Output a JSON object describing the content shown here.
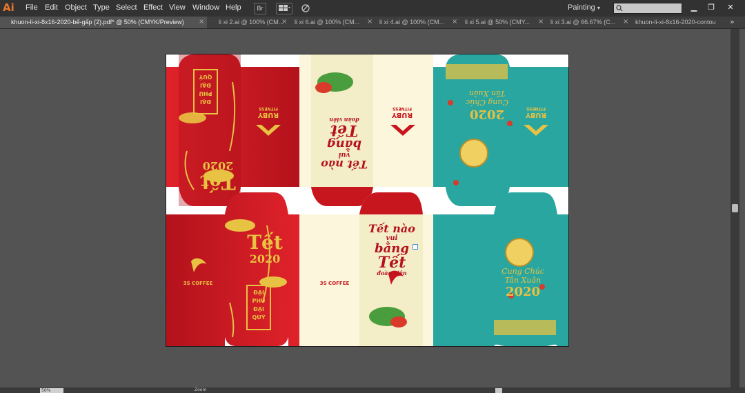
{
  "app": {
    "logo": "Ai"
  },
  "menu": [
    "File",
    "Edit",
    "Object",
    "Type",
    "Select",
    "Effect",
    "View",
    "Window",
    "Help"
  ],
  "toolbar": {
    "bridge_label": "Br",
    "arrange_icon": "arrange-documents-icon",
    "gpu_icon": "gpu-performance-icon"
  },
  "workspace": {
    "label": "Painting"
  },
  "search": {
    "placeholder": ""
  },
  "window_controls": {
    "minimize": "▁",
    "restore": "❐",
    "close": "✕"
  },
  "tabs": [
    {
      "label": "khuon-li-xi-8x16-2020-bế-gấp (2).pdf* @ 50% (CMYK/Preview)",
      "active": true
    },
    {
      "label": "li xi 2.ai @ 100% (CM...",
      "active": false
    },
    {
      "label": "li xi 6.ai @ 100% (CM...",
      "active": false
    },
    {
      "label": "li xi 4.ai @ 100% (CM...",
      "active": false
    },
    {
      "label": "li xi 5.ai @ 50% (CMY...",
      "active": false
    },
    {
      "label": "li xi 3.ai @ 66.67% (C...",
      "active": false
    },
    {
      "label": "khuon-li-xi-8x16-2020-contou",
      "active": false
    }
  ],
  "tab_close": "×",
  "artwork": {
    "tet": "Tết",
    "year": "2020",
    "phu_quy": [
      "ĐẠI",
      "PHÚ",
      "ĐẠI",
      "QUÝ"
    ],
    "brand_ruby": "RUBY",
    "brand_ruby_sub": "FITNESS",
    "brand_coffee": "3S COFFEE",
    "calli_1": "Tết nào",
    "calli_2": "vui",
    "calli_3": "bằng",
    "calli_4": "Tết",
    "calli_5": "đoàn viên",
    "cung_chuc": "Cung Chúc",
    "tan_xuan": "Tân Xuân"
  },
  "statusbar": {
    "zoom": "50%",
    "tool": "Zoom"
  },
  "colors": {
    "red": "#c8161e",
    "dark_red": "#a8101a",
    "cream": "#fbf6dc",
    "teal": "#2aa6a0",
    "gold": "#e8c242"
  }
}
